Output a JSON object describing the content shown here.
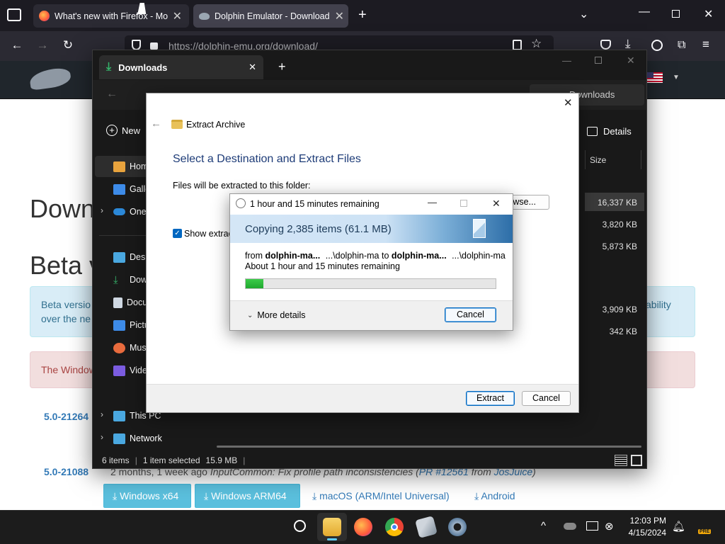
{
  "browser": {
    "tabs": [
      {
        "title": "What's new with Firefox - More"
      },
      {
        "title": "Dolphin Emulator - Download"
      }
    ],
    "url": "https://dolphin-emu.org/download/"
  },
  "website": {
    "heading_download": "Down",
    "heading_beta": "Beta v",
    "beta_alert_line1": "Beta versio",
    "beta_alert_line2": "over the ne",
    "beta_alert_right": "ability",
    "danger_alert": "The Window",
    "versions": [
      {
        "version": "5.0-21264",
        "sep": "|"
      },
      {
        "version": "5.0-21088",
        "age": "2 months, 1 week ago",
        "message": "InputCommon: Fix profile path inconsistencies (",
        "pr": "PR #12561",
        "from": " from ",
        "author": "JosJuice",
        "close": ")"
      }
    ],
    "download_buttons": {
      "windows_x64": "Windows x64",
      "windows_arm64": "Windows ARM64",
      "macos": "macOS (ARM/Intel Universal)",
      "android": "Android"
    }
  },
  "explorer": {
    "tab_title": "Downloads",
    "search_placeholder": "Downloads",
    "new_label": "New",
    "details_label": "Details",
    "column_size": "Size",
    "sidebar": [
      {
        "label": "Home",
        "icon": "home-icon",
        "color": "#e8a33d"
      },
      {
        "label": "Gallery",
        "icon": "gallery-icon",
        "color": "#3d8be8"
      },
      {
        "label": "OneDrive",
        "icon": "onedrive-icon",
        "color": "#2b88d8"
      },
      {
        "label": "Desktop",
        "icon": "desktop-icon",
        "color": "#4aa8e0"
      },
      {
        "label": "Downloads",
        "icon": "downloads-icon",
        "color": "#35b36a"
      },
      {
        "label": "Documents",
        "icon": "documents-icon",
        "color": "#cfd8e2"
      },
      {
        "label": "Pictures",
        "icon": "pictures-icon",
        "color": "#3d8be8"
      },
      {
        "label": "Music",
        "icon": "music-icon",
        "color": "#e86b3d"
      },
      {
        "label": "Videos",
        "icon": "videos-icon",
        "color": "#7b5ce0"
      },
      {
        "label": "This PC",
        "icon": "this-pc-icon",
        "color": "#4aa8e0"
      },
      {
        "label": "Network",
        "icon": "network-icon",
        "color": "#4aa8e0"
      }
    ],
    "sizes": [
      "16,337 KB",
      "3,820 KB",
      "5,873 KB",
      "3,909 KB",
      "342 KB"
    ],
    "status": {
      "items": "6 items",
      "selected": "1 item selected",
      "size": "15.9 MB"
    }
  },
  "extract_dialog": {
    "title": "Extract Archive",
    "heading": "Select a Destination and Extract Files",
    "folder_label": "Files will be extracted to this folder:",
    "browse_label": "owse...",
    "show_label": "Show extract",
    "show_checked": true,
    "extract_button": "Extract",
    "cancel_button": "Cancel"
  },
  "copy_dialog": {
    "title": "1 hour and 15 minutes remaining",
    "banner": "Copying 2,385 items (61.1 MB)",
    "from_label": "from",
    "from_name": "dolphin-ma...",
    "from_path": "...\\dolphin-ma",
    "to_label": "to",
    "to_name": "dolphin-ma...",
    "to_path": "...\\dolphin-ma",
    "remaining": "About 1 hour and 15 minutes remaining",
    "progress": 0.07,
    "more_details": "More details",
    "cancel_button": "Cancel"
  },
  "taskbar": {
    "time": "12:03 PM",
    "date": "4/15/2024",
    "badge": "PRE"
  }
}
